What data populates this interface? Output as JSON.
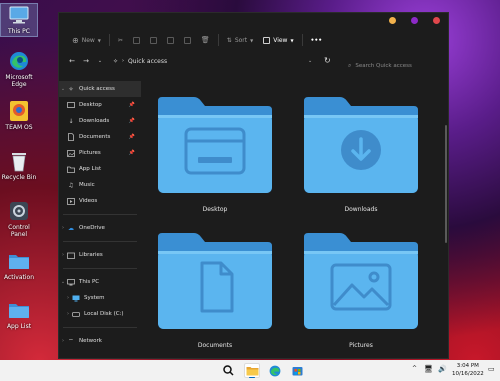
{
  "desktop": {
    "icons": [
      {
        "label": "This PC",
        "icon": "computer-icon"
      },
      {
        "label": "Microsoft Edge",
        "icon": "edge-icon"
      },
      {
        "label": "TEAM OS",
        "icon": "teamos-icon"
      },
      {
        "label": "Recycle Bin",
        "icon": "recycle-bin-icon"
      },
      {
        "label": "Control Panel",
        "icon": "control-panel-icon"
      },
      {
        "label": "Activation",
        "icon": "folder-icon"
      },
      {
        "label": "App List",
        "icon": "folder-icon"
      }
    ]
  },
  "window": {
    "controls": {
      "colors": [
        "#f2b14c",
        "#8d2ac7",
        "#e0474c"
      ]
    },
    "toolbar": {
      "new_label": "New",
      "sort_label": "Sort",
      "view_label": "View",
      "more_label": "•••"
    },
    "address": {
      "path": "Quick access",
      "search_placeholder": "Search Quick access"
    },
    "sidebar": {
      "items": [
        {
          "label": "Quick access",
          "icon": "star-icon"
        },
        {
          "label": "Desktop",
          "icon": "desktop-icon"
        },
        {
          "label": "Downloads",
          "icon": "download-icon"
        },
        {
          "label": "Documents",
          "icon": "document-icon"
        },
        {
          "label": "Pictures",
          "icon": "picture-icon"
        },
        {
          "label": "App List",
          "icon": "folder-icon"
        },
        {
          "label": "Music",
          "icon": "music-icon"
        },
        {
          "label": "Videos",
          "icon": "video-icon"
        },
        {
          "label": "OneDrive",
          "icon": "cloud-icon"
        },
        {
          "label": "Libraries",
          "icon": "library-icon"
        },
        {
          "label": "This PC",
          "icon": "computer-icon"
        },
        {
          "label": "System",
          "icon": "system-icon"
        },
        {
          "label": "Local Disk (C:)",
          "icon": "disk-icon"
        },
        {
          "label": "Network",
          "icon": "network-icon"
        }
      ]
    },
    "folders": [
      {
        "name": "Desktop",
        "glyph": "desktop-glyph"
      },
      {
        "name": "Downloads",
        "glyph": "download-glyph"
      },
      {
        "name": "Documents",
        "glyph": "document-glyph"
      },
      {
        "name": "Pictures",
        "glyph": "picture-glyph"
      }
    ]
  },
  "taskbar": {
    "time": "3:04 PM",
    "date": "10/16/2022",
    "accent": "#0067c0"
  }
}
